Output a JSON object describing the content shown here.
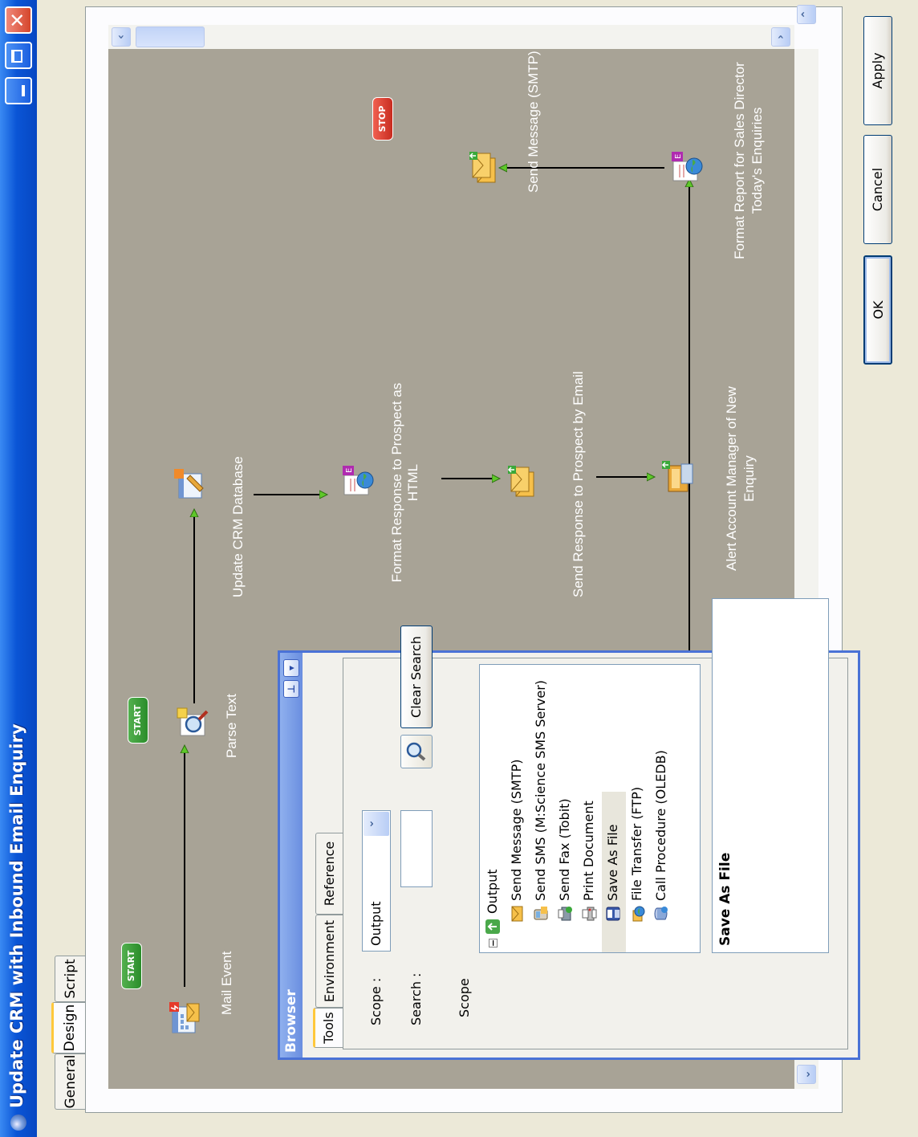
{
  "window": {
    "title": "Update CRM with Inbound Email Enquiry"
  },
  "tabs": [
    {
      "label": "General"
    },
    {
      "label": "Design"
    },
    {
      "label": "Script"
    }
  ],
  "buttons": {
    "ok": "OK",
    "cancel": "Cancel",
    "apply": "Apply"
  },
  "flow": {
    "start_badge": "START",
    "stop_badge": "STOP",
    "nodes": [
      {
        "label": "Mail Event",
        "icon": "mail-event-icon"
      },
      {
        "label": "Parse Text",
        "icon": "parse-text-icon"
      },
      {
        "label": "Update CRM Database",
        "icon": "database-update-icon"
      },
      {
        "label": "Format Response to Prospect as HTML",
        "line1": "Format Response to Prospect as",
        "line2": "HTML",
        "icon": "html-format-icon"
      },
      {
        "label": "Send Response to Prospect by Email",
        "icon": "send-email-icon"
      },
      {
        "label": "Alert Account Manager of New Enquiry",
        "line1": "Alert Account Manager of New",
        "line2": "Enquiry",
        "icon": "alert-icon"
      },
      {
        "label": "Format Report for Sales Director Today's Enquiries",
        "line1": "Format Report for Sales Director",
        "line2": "Today's Enquiries",
        "icon": "html-format-icon"
      },
      {
        "label": "Send Message (SMTP)",
        "icon": "send-email-icon"
      }
    ]
  },
  "browser": {
    "title": "Browser",
    "tabs": [
      {
        "label": "Tools"
      },
      {
        "label": "Environment"
      },
      {
        "label": "Reference"
      }
    ],
    "scope_label": "Scope :",
    "scope_value": "Output",
    "search_label": "Search :",
    "search_value": "",
    "clear_search": "Clear Search",
    "tree_header": "Scope",
    "tree_root": "Output",
    "tree_items": [
      {
        "label": "Send Message (SMTP)",
        "icon": "envelope-icon"
      },
      {
        "label": "Send SMS (M:Science SMS Server)",
        "icon": "sms-icon"
      },
      {
        "label": "Send Fax (Tobit)",
        "icon": "fax-icon"
      },
      {
        "label": "Print Document",
        "icon": "printer-icon"
      },
      {
        "label": "Save As File",
        "icon": "floppy-icon",
        "selected": true
      },
      {
        "label": "File Transfer (FTP)",
        "icon": "ftp-icon"
      },
      {
        "label": "Call Procedure (OLEDB)",
        "icon": "database-icon"
      }
    ],
    "description_title": "Save As File"
  },
  "colors": {
    "titlebar": "#0a55d6",
    "canvas": "#a8a396",
    "selected_row": "#e8e6dc",
    "start": "#2a8d2a",
    "stop": "#c82c20",
    "flow_arrow": "#5fc82a"
  }
}
